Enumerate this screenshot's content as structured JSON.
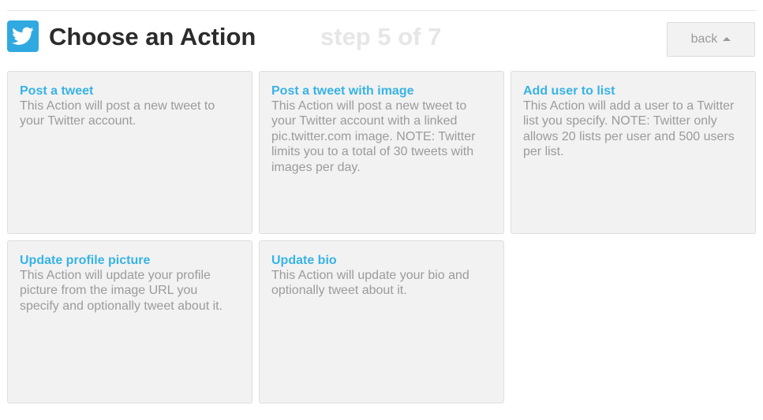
{
  "header": {
    "logo_icon": "twitter-bird-icon",
    "title": "Choose an Action",
    "step": "step 5 of 7",
    "back_label": "back",
    "back_icon": "caret-up-icon"
  },
  "colors": {
    "brand": "#2fa9e0",
    "link": "#37b3e5",
    "card_bg": "#f2f2f2",
    "muted_text": "#9b9b9b"
  },
  "actions": [
    {
      "title": "Post a tweet",
      "description": "This Action will post a new tweet to your Twitter account."
    },
    {
      "title": "Post a tweet with image",
      "description": "This Action will post a new tweet to your Twitter account with a linked pic.twitter.com image. NOTE: Twitter limits you to a total of 30 tweets with images per day."
    },
    {
      "title": "Add user to list",
      "description": "This Action will add a user to a Twitter list you specify. NOTE: Twitter only allows 20 lists per user and 500 users per list."
    },
    {
      "title": "Update profile picture",
      "description": "This Action will update your profile picture from the image URL you specify and optionally tweet about it."
    },
    {
      "title": "Update bio",
      "description": "This Action will update your bio and optionally tweet about it."
    }
  ]
}
